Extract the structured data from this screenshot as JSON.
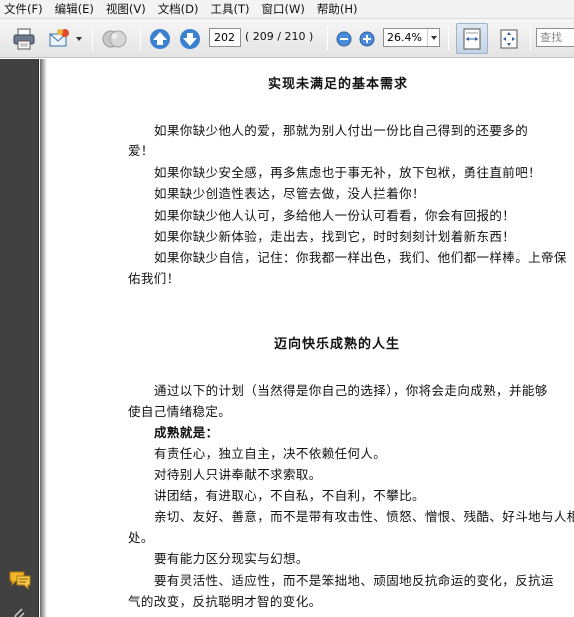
{
  "menu": [
    "文件(F)",
    "编辑(E)",
    "视图(V)",
    "文档(D)",
    "工具(T)",
    "窗口(W)",
    "帮助(H)"
  ],
  "toolbar": {
    "current_page": "202",
    "page_total": "( 209 / 210 )",
    "zoom": "26.4%",
    "search_placeholder": "查找"
  },
  "document": {
    "section1": {
      "title": "实现未满足的基本需求",
      "lines": [
        "如果你缺少他人的爱，那就为别人付出一份比自己得到的还要多的",
        "爱！",
        "如果你缺少安全感，再多焦虑也于事无补，放下包袱，勇往直前吧！",
        "如果缺少创造性表达，尽管去做，没人拦着你！",
        "如果你缺少他人认可，多给他人一份认可看看，你会有回报的！",
        "如果你缺少新体验，走出去，找到它，时时刻刻计划着新东西！",
        "如果你缺少自信，记住：你我都一样出色，我们、他们都一样棒。上帝保",
        "佑我们！"
      ]
    },
    "section2": {
      "title": "迈向快乐成熟的人生",
      "lines": [
        "通过以下的计划（当然得是你自己的选择），你将会走向成熟，并能够",
        "使自己情绪稳定。",
        "成熟就是：",
        "有责任心，独立自主，决不依赖任何人。",
        "对待别人只讲奉献不求索取。",
        "讲团结，有进取心，不自私，不自利，不攀比。",
        "亲切、友好、善意，而不是带有攻击性、愤怒、憎恨、残酷、好斗地与人相",
        "处。",
        "要有能力区分现实与幻想。",
        "要有灵活性、适应性，而不是笨拙地、顽固地反抗命运的变化，反抗运",
        "气的改变，反抗聪明才智的变化。"
      ]
    }
  }
}
